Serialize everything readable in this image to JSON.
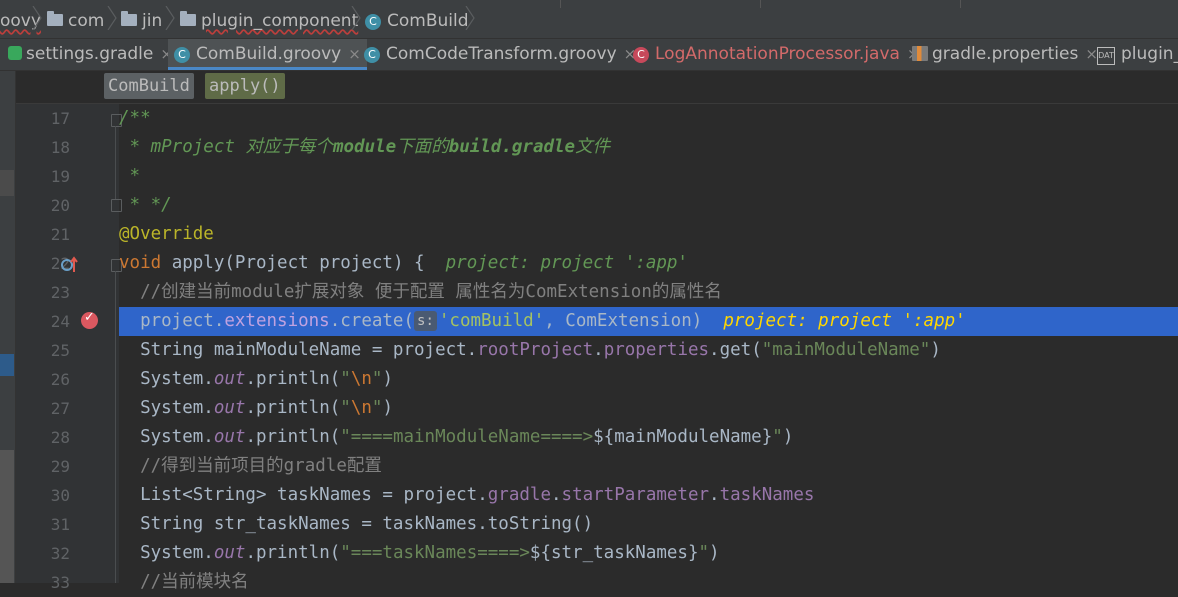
{
  "breadcrumb": {
    "items": [
      "oovy",
      "com",
      "jin",
      "plugin_component",
      "ComBuild"
    ]
  },
  "tabs": [
    {
      "label": "settings.gradle",
      "close": "×"
    },
    {
      "label": "ComBuild.groovy",
      "close": "×"
    },
    {
      "label": "ComCodeTransform.groovy",
      "close": "×"
    },
    {
      "label": "LogAnnotationProcessor.java",
      "close": "×"
    },
    {
      "label": "gradle.properties",
      "close": "×"
    },
    {
      "label": "plugin_c"
    }
  ],
  "member_breadcrumb": {
    "class_name": "ComBuild",
    "method": "apply()"
  },
  "line_numbers": [
    "17",
    "18",
    "19",
    "20",
    "21",
    "22",
    "23",
    "24",
    "25",
    "26",
    "27",
    "28",
    "29",
    "30",
    "31",
    "32",
    "33"
  ],
  "code": {
    "l17": "/**",
    "l18_a": " * mProject ",
    "l18_b": "对应于每个",
    "l18_c": "module",
    "l18_d": "下面的",
    "l18_e": "build.gradle",
    "l18_f": "文件",
    "l19": " *",
    "l20": " * */",
    "l21": "@Override",
    "l22_kw": "void",
    "l22_rest": " apply(Project project) {  ",
    "l22_hint": "project: project ':app'",
    "l23": "  //创建当前module扩展对象 便于配置 属性名为ComExtension的属性名",
    "l24_a": "  project.",
    "l24_b": "extensions",
    "l24_c": ".create(",
    "l24_badge": "s:",
    "l24_d": "'comBuild'",
    "l24_e": ", ComExtension)  ",
    "l24_hint": "project: project ':app'",
    "l25_a": "  String mainModuleName = project.",
    "l25_b": "rootProject",
    "l25_c": ".",
    "l25_d": "properties",
    "l25_e": ".get(",
    "l25_f": "\"mainModuleName\"",
    "l25_g": ")",
    "l26_a": "  System.",
    "l26_b": "out",
    "l26_c": ".println(",
    "l26_d": "\"",
    "l26_e": "\\n",
    "l26_f": "\"",
    "l26_g": ")",
    "l27_a": "  System.",
    "l27_b": "out",
    "l27_c": ".println(",
    "l27_d": "\"",
    "l27_e": "\\n",
    "l27_f": "\"",
    "l27_g": ")",
    "l28_a": "  System.",
    "l28_b": "out",
    "l28_c": ".println(",
    "l28_d": "\"====mainModuleName====>",
    "l28_e": "${mainModuleName}",
    "l28_f": "\"",
    "l28_g": ")",
    "l29": "  //得到当前项目的gradle配置",
    "l30_a": "  List<String> taskNames = project.",
    "l30_b": "gradle",
    "l30_c": ".",
    "l30_d": "startParameter",
    "l30_e": ".",
    "l30_f": "taskNames",
    "l31": "  String str_taskNames = taskNames.toString()",
    "l32_a": "  System.",
    "l32_b": "out",
    "l32_c": ".println(",
    "l32_d": "\"===taskNames====>",
    "l32_e": "${str_taskNames}",
    "l32_f": "\"",
    "l32_g": ")",
    "l33": "  //当前模块名"
  },
  "icons": {
    "class": "C",
    "breakpoint": "breakpoint-icon",
    "override": "override-icon"
  },
  "colors": {
    "keyword": "#cc7832",
    "string": "#6a8759",
    "comment": "#629755",
    "field": "#9876aa",
    "selection": "#2f65ca"
  }
}
